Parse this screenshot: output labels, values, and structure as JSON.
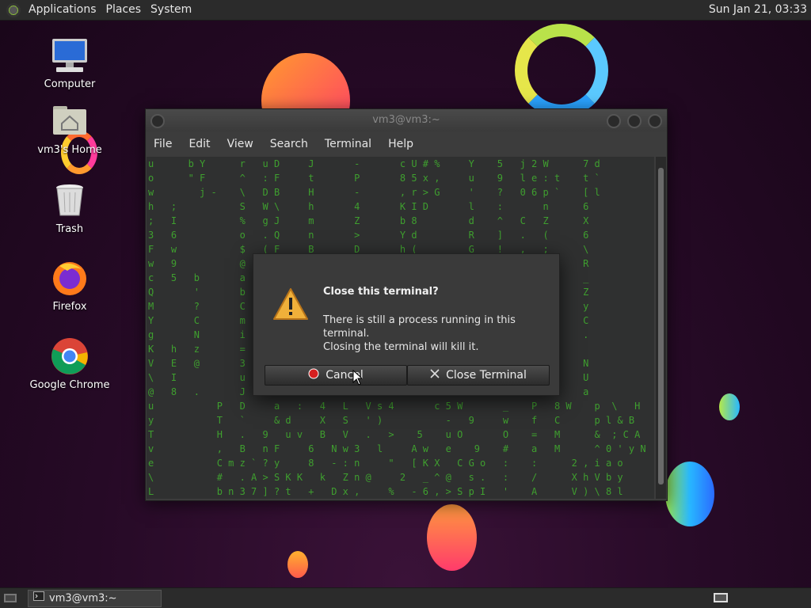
{
  "panel": {
    "menus": [
      "Applications",
      "Places",
      "System"
    ],
    "clock": "Sun Jan 21, 03:33"
  },
  "desktop": {
    "icons": [
      {
        "label": "Computer",
        "icon": "computer-icon"
      },
      {
        "label": "vm3's Home",
        "icon": "home-folder-icon"
      },
      {
        "label": "Trash",
        "icon": "trash-icon"
      },
      {
        "label": "Firefox",
        "icon": "firefox-icon"
      },
      {
        "label": "Google Chrome",
        "icon": "chrome-icon"
      }
    ]
  },
  "terminal_window": {
    "title": "vm3@vm3:~",
    "menus": [
      "File",
      "Edit",
      "View",
      "Search",
      "Terminal",
      "Help"
    ]
  },
  "terminal_text": [
    "u      b Y      r   u D     J       -       c U # %     Y    5   j 2 W      7 d",
    "o      \" F      ^   : F     t       P       8 5 x ,     u    9   l e : t    t `",
    "w        j -    \\   D B     H       -       , r > G     '    ?   0 6 p `    [ l",
    "h   ;           S   W \\     h       4       K I D       l    :       n      6",
    ";   I           %   g J     m       Z       b 8         d    ^   C   Z      X",
    "3   6           o   . Q     n       >       Y d         R    ]   .   (      6",
    "F   w           $   ( F     B       D       h (         G    !   ,   ;      \\",
    "w   9           @   c `     I       G       ( u         .    ;   ,   6      R",
    "c   5   b       a                                                    M \"    _",
    "Q       '       b                                                    6 %    Z",
    "M       ?       C                                                    * =    y",
    "Y       C       m                                                    a [    C",
    "g       N       i                                                    d z    .",
    "K   h   z       =                                                    z y",
    "V   E   @       3                                                    9 d    N",
    "\\   I           u                                                    k m    U",
    "@   8   .       J                                                    B z    a",
    "u           P   D     a   :   4   L   V s 4       c 5 W       _    P   8 W    p  \\   H",
    "y           T   `     & d     X   S   ' )           -   9     w    f   C      p l & B",
    "T           H   .   9   u v   B   V   .   >    5    u O       O    =   M      &  ; C A",
    "v           ,   B   n F     6   N w 3   l     A w   e    9    #    a   M      ^ 0 ' y N",
    "e           C m z ` ? y     8   - : n     \"   [ K X   C G o   :    :      2 , i a o",
    "\\           #   . A > S K K   k   Z n @     2   _ ^ @   s .   :    /      X h V b y",
    "L           b n 3 7 ] ? t   +   D x ,     %   - 6 , > S p I   '    A      V ) \\ 8 l"
  ],
  "dialog": {
    "title": "Close this terminal?",
    "message_line1": "There is still a process running in this terminal.",
    "message_line2": "Closing the terminal will kill it.",
    "cancel_label": "Cancel",
    "close_label": "Close Terminal"
  },
  "taskbar": {
    "task_label": "vm3@vm3:~"
  }
}
